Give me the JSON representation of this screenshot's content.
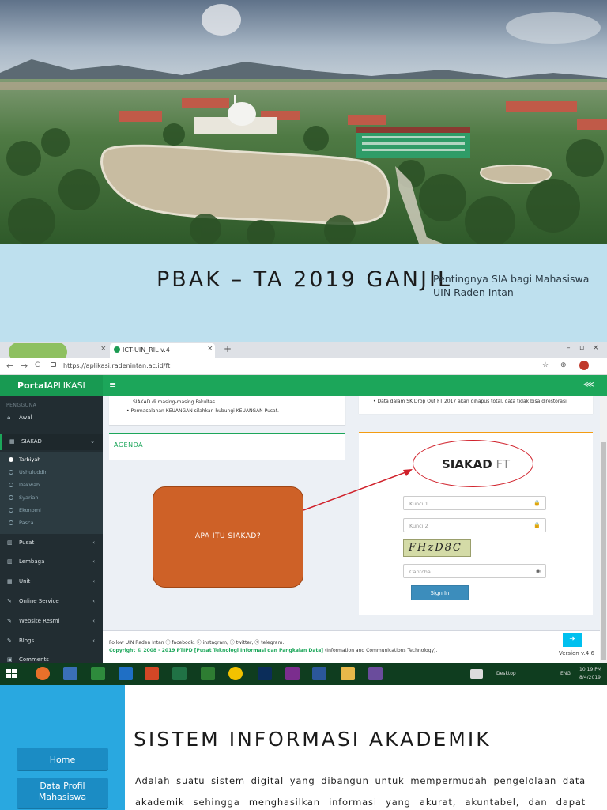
{
  "slide1": {
    "title": "PBAK – TA 2019 GANJIL",
    "subtitle_line1": "Pentingnya SIA bagi Mahasiswa",
    "subtitle_line2": "UIN Raden Intan"
  },
  "browser": {
    "tabs": [
      {
        "label": "",
        "close": "×"
      },
      {
        "label": "ICT-UIN_RIL v.4",
        "close": "×"
      }
    ],
    "new_tab": "+",
    "window_controls": [
      "–",
      "▫",
      "×"
    ],
    "nav": {
      "back": "←",
      "forward": "→",
      "reload": "C"
    },
    "url": "https://aplikasi.radenintan.ac.id/ft",
    "addr_icons": {
      "star": "☆",
      "ext": "⊕"
    }
  },
  "app": {
    "brand_bold": "Portal",
    "brand_rest": "APLIKASI",
    "menu_toggle": "≡",
    "share_icon": "⋘",
    "sidebar": {
      "header": "PENGGUNA",
      "items": [
        {
          "icon": "⌂",
          "label": "Awal"
        },
        {
          "icon": "▦",
          "label": "SIAKAD",
          "chev": "⌄"
        },
        {
          "icon": "▥",
          "label": "Pusat",
          "chev": "‹"
        },
        {
          "icon": "▥",
          "label": "Lembaga",
          "chev": "‹"
        },
        {
          "icon": "▦",
          "label": "Unit",
          "chev": "‹"
        },
        {
          "icon": "✎",
          "label": "Online Service",
          "chev": "‹"
        },
        {
          "icon": "✎",
          "label": "Website Resmi",
          "chev": "‹"
        },
        {
          "icon": "✎",
          "label": "Blogs",
          "chev": "‹"
        },
        {
          "icon": "▣",
          "label": "Comments"
        }
      ],
      "subitems": [
        "Tarbiyah",
        "Ushuluddin",
        "Dakwah",
        "Syariah",
        "Ekonomi",
        "Pasca"
      ]
    },
    "content": {
      "bullet_line1": "SIAKAD di masing-masing Fakultas.",
      "bullet_line2": "• Permasalahan KEUANGAN silahkan hubungi KEUANGAN Pusat.",
      "bullet_right": "• Data dalam SK Drop Out FT 2017 akan dihapus total, data tidak bisa direstorasi.",
      "agenda": "AGENDA",
      "login_title_bold": "SIAKAD",
      "login_title_rest": "FT",
      "field1": "Kunci 1",
      "field2": "Kunci 2",
      "captcha_text": "FHzD8C",
      "captcha_field": "Captcha",
      "signin": "Sign In"
    },
    "footer": {
      "follow": "Follow UIN Raden Intan ⓕ facebook, ⓘ instagram, ⓣ twitter, ⓣ telegram.",
      "copyright": "Copyright © 2008 - 2019 PTIPD [Pusat Teknologi Informasi dan Pangkalan Data]",
      "copyright_rest": "(Information and Communications Technology).",
      "version": "Version v.4.6",
      "up": "➜"
    }
  },
  "overlay": {
    "question": "APA ITU SIAKAD?"
  },
  "taskbar": {
    "desktop": "Desktop",
    "lang": "ENG",
    "time": "10:19 PM",
    "date": "8/4/2019"
  },
  "slide2": {
    "title": "SISTEM INFORMASI AKADEMIK",
    "paragraph": "Adalah suatu sistem digital yang dibangun untuk mempermudah pengelolaan data akademik sehingga menghasilkan informasi yang akurat, akuntabel, dan dapat dipertanggung jawabkan.",
    "nav": [
      "Home",
      "Data Profil Mahasiswa"
    ]
  },
  "colors": {
    "title_band": "#bee0ee",
    "app_green": "#1ca65a",
    "overlay_orange": "#ce6127",
    "slide2_blue": "#29a8e0"
  }
}
